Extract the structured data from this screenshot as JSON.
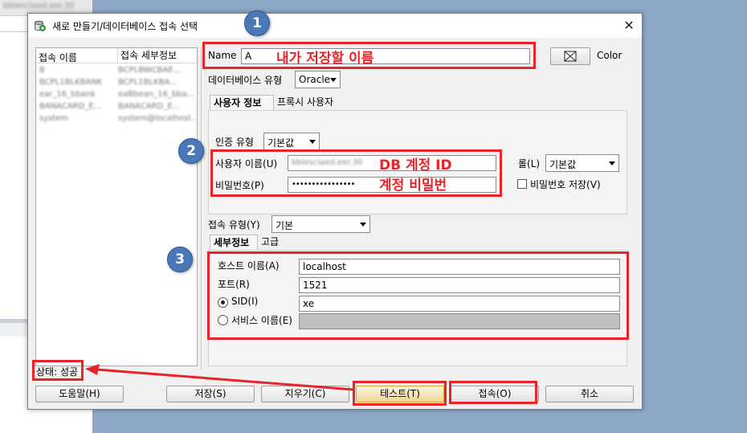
{
  "window": {
    "title": "새로 만들기/데이터베이스 접속 선택",
    "close": "✕"
  },
  "connection_list": {
    "headers": [
      "접속 이름",
      "접속 세부정보"
    ],
    "rows": [
      [
        "B",
        "BCPLBWCBAE..."
      ],
      [
        "BCPL1BLKBANK",
        "BCPL1BLKBA..."
      ],
      [
        "ear_16_bbank",
        "eaBbean_16_bba..."
      ],
      [
        "BANACARD_E...",
        "BANACARD_E..."
      ],
      [
        "system",
        "system@localhost..."
      ]
    ]
  },
  "form": {
    "name_label": "Name",
    "name_value": "A",
    "color_label": "Color",
    "db_type_label": "데이터베이스 유형",
    "db_type_value": "Oracle",
    "tabs": [
      "사용자 정보",
      "프록시 사용자"
    ],
    "auth_type_label": "인증 유형",
    "auth_type_value": "기본값",
    "username_label": "사용자 이름(U)",
    "username_value": "bblesclaed.eer.30",
    "password_label": "비밀번호(P)",
    "password_value": "••••••••••••••••",
    "role_label": "롤(L)",
    "role_value": "기본값",
    "save_password_label": "비밀번호 저장(V)",
    "conn_type_label": "접속 유형(Y)",
    "conn_type_value": "기본",
    "detail_tabs": [
      "세부정보",
      "고급"
    ],
    "host_label": "호스트 이름(A)",
    "host_value": "localhost",
    "port_label": "포트(R)",
    "port_value": "1521",
    "sid_label": "SID(I)",
    "sid_value": "xe",
    "service_label": "서비스 이름(E)",
    "service_value": ""
  },
  "status": "상태: 성공",
  "buttons": {
    "help": "도움말(H)",
    "save": "저장(S)",
    "clear": "지우기(C)",
    "test": "테스트(T)",
    "connect": "접속(O)",
    "cancel": "취소"
  },
  "annotations": {
    "badge1": "1",
    "badge2": "2",
    "badge3": "3",
    "name_note": "내가 저장할 이름",
    "db_id_note": "DB 계정 ID",
    "pw_note": "계정 비밀번"
  },
  "background": {
    "blurred_text": "bblesclaed.eer.30"
  },
  "colors": {
    "annotation_red": "#e8232a",
    "badge_blue": "#4a78b8"
  }
}
